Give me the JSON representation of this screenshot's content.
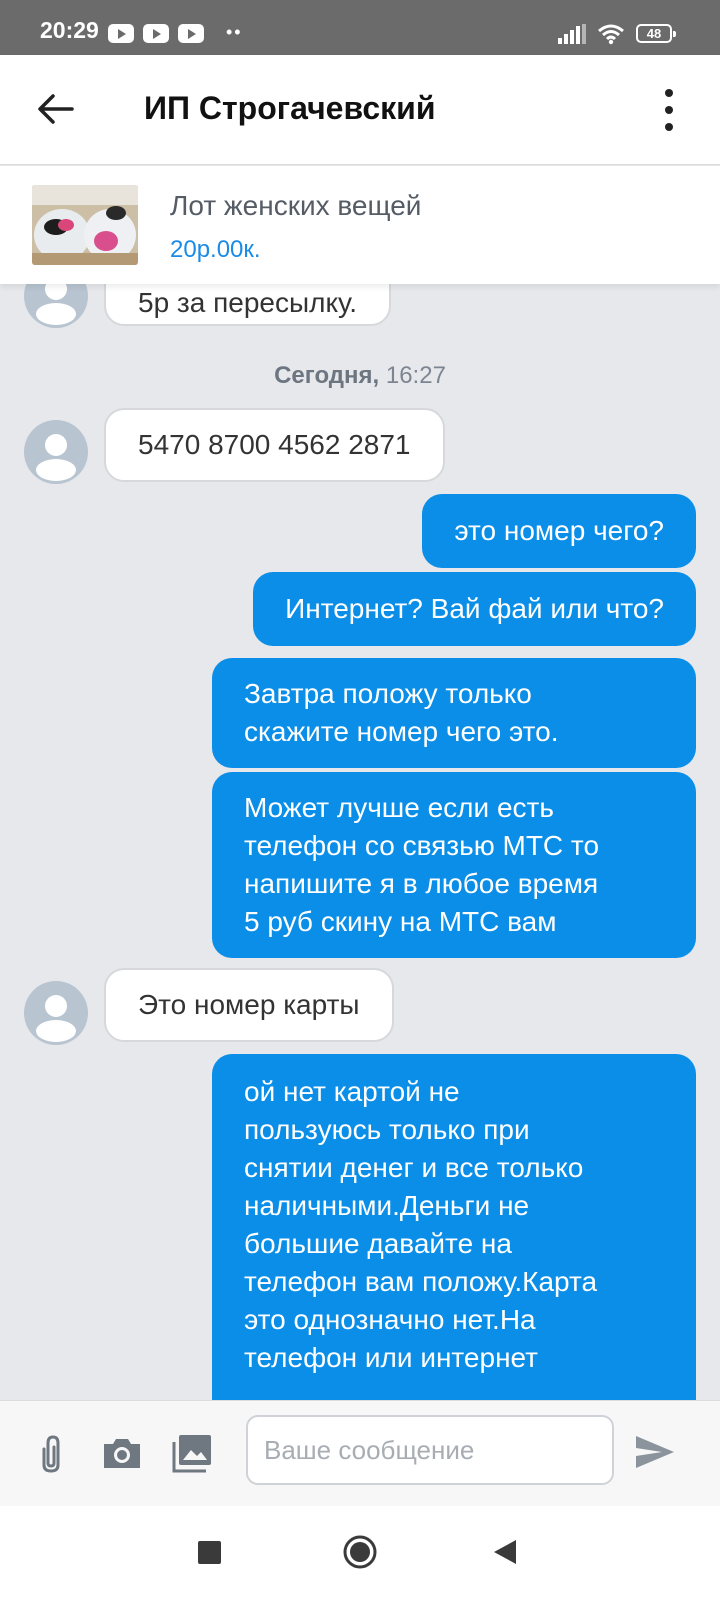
{
  "status_bar": {
    "time": "20:29",
    "battery": "48",
    "icons": [
      "youtube-icon",
      "youtube-icon",
      "youtube-icon",
      "more-dots",
      "signal-icon",
      "wifi-icon",
      "battery-icon"
    ]
  },
  "header": {
    "title": "ИП Строгачевский",
    "icons": [
      "back-arrow-icon",
      "more-vertical-icon"
    ]
  },
  "product": {
    "name": "Лот женских вещей",
    "price": "20р.00к."
  },
  "chat": {
    "date_label": "Сегодня,",
    "date_time": "16:27",
    "messages": [
      {
        "direction": "in",
        "lines": [
          "5р за пересылку."
        ]
      },
      {
        "direction": "in",
        "lines": [
          "5470 8700 4562 2871"
        ]
      },
      {
        "direction": "out",
        "lines": [
          "это номер чего?"
        ]
      },
      {
        "direction": "out",
        "lines": [
          "Интернет? Вай фай или что?"
        ]
      },
      {
        "direction": "out",
        "lines": [
          "Завтра положу только",
          "скажите номер чего это."
        ]
      },
      {
        "direction": "out",
        "lines": [
          "Может лучше если есть",
          "телефон со связью МТС то",
          "напишите я в любое время",
          "5 руб скину на МТС вам"
        ]
      },
      {
        "direction": "in",
        "lines": [
          "Это номер карты"
        ]
      },
      {
        "direction": "out",
        "lines": [
          "ой нет картой не",
          "пользуюсь только при",
          "снятии денег и все только",
          "наличными.Деньги не",
          "большие давайте на",
          "телефон вам положу.Карта",
          "это однозначно нет.На",
          "телефон или интернет"
        ]
      }
    ]
  },
  "composer": {
    "placeholder": "Ваше сообщение",
    "icons": [
      "paperclip-icon",
      "camera-icon",
      "gallery-icon",
      "send-icon"
    ]
  },
  "colors": {
    "accent": "#0a8ee8",
    "price": "#1a8be6",
    "chat_bg": "#e7e8ec",
    "status_bar": "#6b6b6b"
  }
}
